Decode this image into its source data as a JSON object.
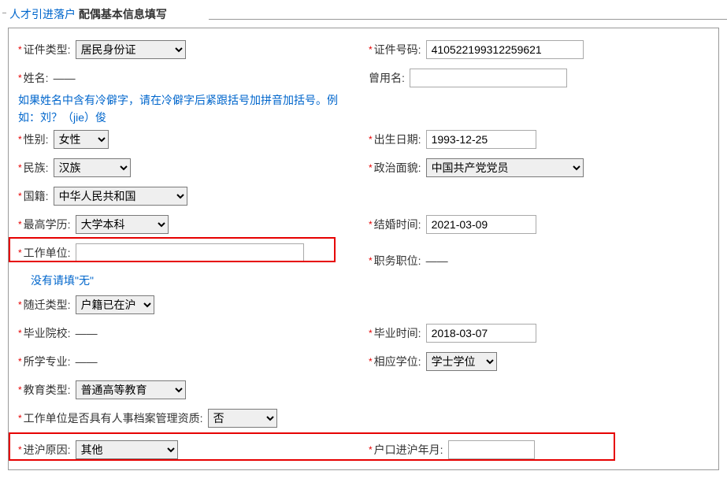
{
  "header": {
    "link": "人才引进落户",
    "suffix": "配偶基本信息填写"
  },
  "labels": {
    "idType": "证件类型:",
    "idNumber": "证件号码:",
    "name": "姓名:",
    "formerName": "曾用名:",
    "gender": "性别:",
    "birthDate": "出生日期:",
    "nation": "民族:",
    "political": "政治面貌:",
    "nationality": "国籍:",
    "education": "最高学历:",
    "marryTime": "结婚时间:",
    "workUnit": "工作单位:",
    "position": "职务职位:",
    "moveType": "随迁类型:",
    "gradSchool": "毕业院校:",
    "gradTime": "毕业时间:",
    "major": "所学专业:",
    "degree": "相应学位:",
    "eduType": "教育类型:",
    "hasArchive": "工作单位是否具有人事档案管理资质:",
    "shReason": "进沪原因:",
    "shDate": "户口进沪年月:"
  },
  "values": {
    "idType": "居民身份证",
    "idNumber": "410522199312259621",
    "name": "——",
    "formerName": "",
    "gender": "女性",
    "birthDate": "1993-12-25",
    "nation": "汉族",
    "political": "中国共产党党员",
    "nationality": "中华人民共和国",
    "education": "大学本科",
    "marryTime": "2021-03-09",
    "workUnit": "",
    "position": "——",
    "moveType": "户籍已在沪",
    "gradSchool": "——",
    "gradTime": "2018-03-07",
    "major": "——",
    "degree": "学士学位",
    "eduType": "普通高等教育",
    "hasArchive": "否",
    "shReason": "其他",
    "shDate": ""
  },
  "hints": {
    "nameHint": "如果姓名中含有冷僻字，请在冷僻字后紧跟括号加拼音加括号。例如：刘？（jie）俊",
    "workUnitHint": "没有请填\"无\""
  }
}
